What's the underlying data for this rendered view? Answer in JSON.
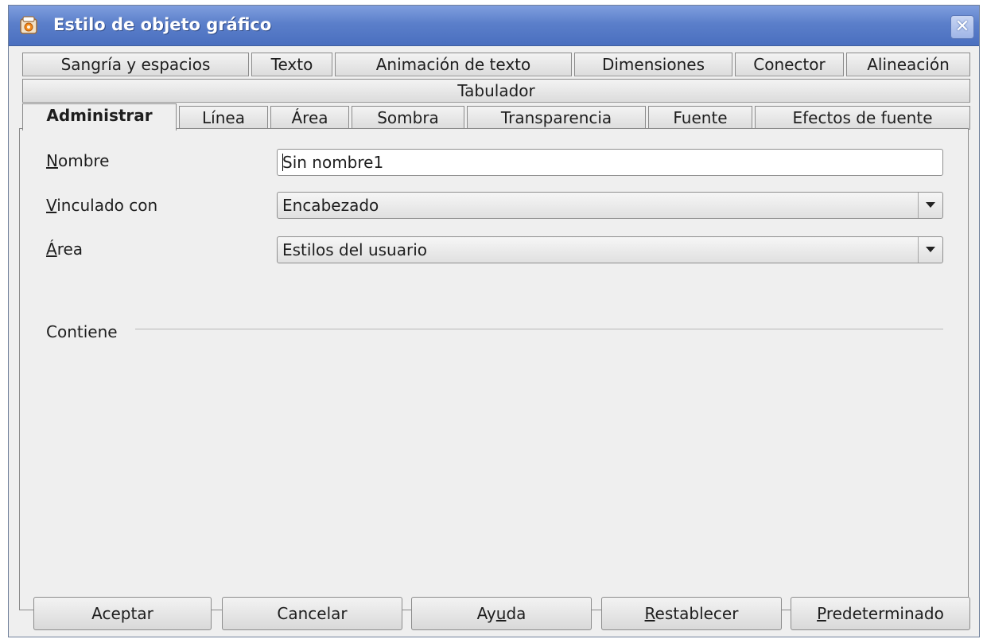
{
  "window": {
    "title": "Estilo de objeto gráfico",
    "close_glyph": "✕",
    "app_icon": "office-app-icon"
  },
  "tabs": {
    "row1": [
      "Sangría y espacios",
      "Texto",
      "Animación de texto",
      "Dimensiones",
      "Conector",
      "Alineación"
    ],
    "row2": [
      "Tabulador"
    ],
    "row3": [
      "Administrar",
      "Línea",
      "Área",
      "Sombra",
      "Transparencia",
      "Fuente",
      "Efectos de fuente"
    ],
    "active": "Administrar"
  },
  "form": {
    "nombre_label_mnemonic": "N",
    "nombre_label_rest": "ombre",
    "nombre_value": "Sin nombre1",
    "vinculado_label_mnemonic": "V",
    "vinculado_label_rest": "inculado con",
    "vinculado_value": "Encabezado",
    "area_label_mnemonic": "Á",
    "area_label_rest": "rea",
    "area_value": "Estilos del usuario",
    "contiene_label": "Contiene"
  },
  "buttons": {
    "aceptar": "Aceptar",
    "cancelar": "Cancelar",
    "ayuda_pre": "Ay",
    "ayuda_mnemonic": "u",
    "ayuda_post": "da",
    "restablecer_mnemonic": "R",
    "restablecer_rest": "establecer",
    "predeterminado_mnemonic": "P",
    "predeterminado_rest": "redeterminado"
  },
  "colors": {
    "titlebar": "#5b7fca",
    "dialog_bg": "#efefef"
  }
}
